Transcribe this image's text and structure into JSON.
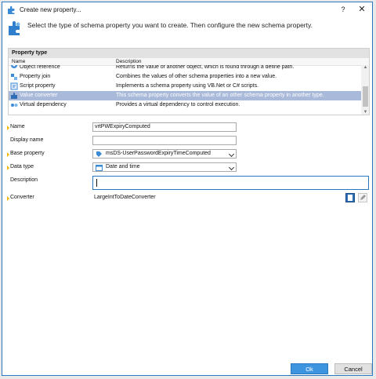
{
  "window": {
    "title": "Create new property...",
    "help_label": "?",
    "close_label": "✕"
  },
  "header": {
    "instruction": "Select the type of schema property you want to create. Then configure the new schema property."
  },
  "property_type": {
    "section_title": "Property type",
    "columns": [
      "Name",
      "Description"
    ],
    "rows": [
      {
        "name": "Object reference",
        "description": "Returns the value of another object, which is found through a define path.",
        "icon": "object-reference-icon"
      },
      {
        "name": "Property join",
        "description": "Combines the values of other schema properties into a new value.",
        "icon": "property-join-icon"
      },
      {
        "name": "Script property",
        "description": "Implements a schema property using VB.Net or C# scripts.",
        "icon": "script-property-icon"
      },
      {
        "name": "Value converter",
        "description": "This schema property converts the value of an other schema property in another type.",
        "icon": "value-converter-icon",
        "selected": true
      },
      {
        "name": "Virtual dependency",
        "description": "Provides a virtual dependency to control execution.",
        "icon": "virtual-dependency-icon"
      }
    ]
  },
  "form": {
    "name_label": "Name",
    "name_value": "vrtPWExpiryComputed",
    "display_name_label": "Display name",
    "display_name_value": "",
    "base_property_label": "Base property",
    "base_property_value": "msDS-UserPasswordExpiryTimeComputed",
    "data_type_label": "Data type",
    "data_type_value": "Date and time",
    "description_label": "Description",
    "description_value": "",
    "converter_label": "Converter",
    "converter_value": "LargeIntToDateConverter"
  },
  "buttons": {
    "ok": "Ok",
    "cancel": "Cancel"
  },
  "colors": {
    "accent": "#3d95df",
    "selected_row": "#a9b9d9",
    "required_marker": "#f2b705"
  }
}
